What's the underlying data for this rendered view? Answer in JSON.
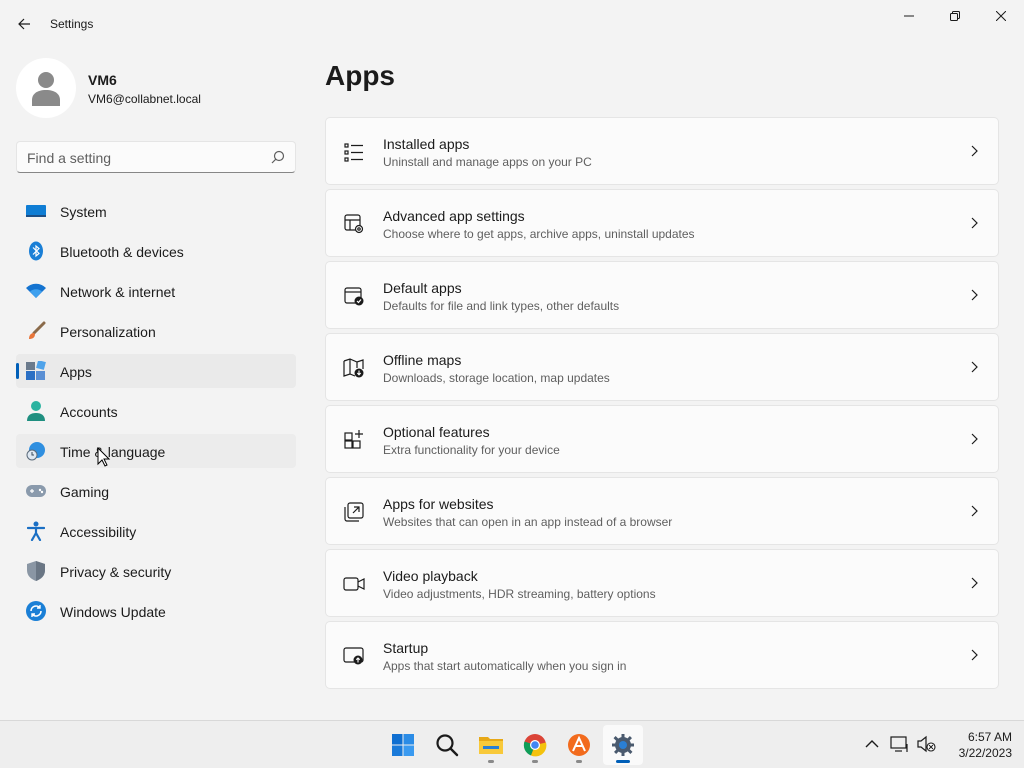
{
  "window": {
    "title": "Settings"
  },
  "profile": {
    "name": "VM6",
    "email": "VM6@collabnet.local"
  },
  "search": {
    "placeholder": "Find a setting"
  },
  "sidebar": {
    "items": [
      {
        "label": "System",
        "icon": "monitor-icon"
      },
      {
        "label": "Bluetooth & devices",
        "icon": "bluetooth-icon"
      },
      {
        "label": "Network & internet",
        "icon": "wifi-icon"
      },
      {
        "label": "Personalization",
        "icon": "paintbrush-icon"
      },
      {
        "label": "Apps",
        "icon": "apps-icon",
        "selected": true
      },
      {
        "label": "Accounts",
        "icon": "person-icon"
      },
      {
        "label": "Time & language",
        "icon": "globe-clock-icon"
      },
      {
        "label": "Gaming",
        "icon": "gamepad-icon"
      },
      {
        "label": "Accessibility",
        "icon": "accessibility-icon"
      },
      {
        "label": "Privacy & security",
        "icon": "shield-icon"
      },
      {
        "label": "Windows Update",
        "icon": "update-icon"
      }
    ]
  },
  "main": {
    "title": "Apps",
    "cards": [
      {
        "title": "Installed apps",
        "desc": "Uninstall and manage apps on your PC",
        "icon": "list-icon"
      },
      {
        "title": "Advanced app settings",
        "desc": "Choose where to get apps, archive apps, uninstall updates",
        "icon": "app-settings-icon"
      },
      {
        "title": "Default apps",
        "desc": "Defaults for file and link types, other defaults",
        "icon": "default-apps-icon"
      },
      {
        "title": "Offline maps",
        "desc": "Downloads, storage location, map updates",
        "icon": "map-icon"
      },
      {
        "title": "Optional features",
        "desc": "Extra functionality for your device",
        "icon": "optional-features-icon"
      },
      {
        "title": "Apps for websites",
        "desc": "Websites that can open in an app instead of a browser",
        "icon": "open-link-icon"
      },
      {
        "title": "Video playback",
        "desc": "Video adjustments, HDR streaming, battery options",
        "icon": "video-camera-icon"
      },
      {
        "title": "Startup",
        "desc": "Apps that start automatically when you sign in",
        "icon": "startup-icon"
      }
    ]
  },
  "taskbar": {
    "apps": [
      "windows-start-icon",
      "search-icon",
      "file-explorer-icon",
      "chrome-icon",
      "snapshot-app-icon",
      "settings-gear-icon"
    ],
    "time": "6:57 AM",
    "date": "3/22/2023"
  },
  "colors": {
    "accent": "#005fb8",
    "background": "#f3f3f3",
    "card": "#fbfbfb"
  }
}
